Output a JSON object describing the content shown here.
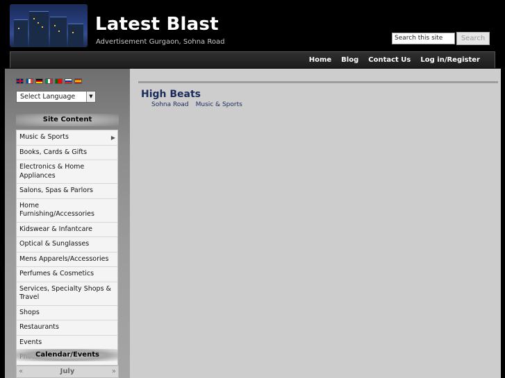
{
  "header": {
    "title": "Latest Blast",
    "tagline": "Advertisement Gurgaon, Sohna Road"
  },
  "search": {
    "placeholder": "Search this site",
    "button_label": "Search"
  },
  "nav": {
    "items": [
      "Home",
      "Blog",
      "Contact Us",
      "Log in/Register"
    ]
  },
  "sidebar": {
    "language_select": {
      "selected": "Select Language"
    },
    "flags": [
      "english-flag-icon",
      "french-flag-icon",
      "german-flag-icon",
      "italian-flag-icon",
      "portuguese-flag-icon",
      "russian-flag-icon",
      "spanish-flag-icon"
    ],
    "site_content_title": "Site Content",
    "menu": [
      "Music & Sports",
      "Books, Cards & Gifts",
      "Electronics & Home Appliances",
      "Salons, Spas & Parlors",
      "Home Furnishing/Accessories",
      "Kidswear & Infantcare",
      "Optical & Sunglasses",
      "Mens Apparels/Accessories",
      "Perfumes & Cosmetics",
      "Services, Specialty Shops & Travel",
      "Shops",
      "Restaurants",
      "Events",
      "Photo Gallery"
    ],
    "calendar_title": "Calendar/Events",
    "calendar": {
      "prev": "«",
      "month": "July",
      "next": "»"
    }
  },
  "main": {
    "post_title": "High Beats",
    "meta": [
      "Sohna Road",
      "Music & Sports"
    ]
  },
  "colors": {
    "title_blue": "#1a2b5a",
    "content_bg": "#cdcdcd"
  }
}
